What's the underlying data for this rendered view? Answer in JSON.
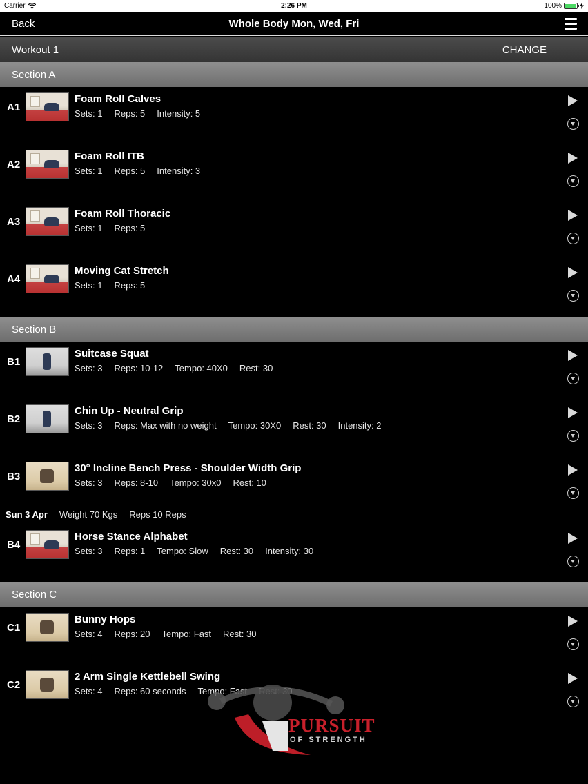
{
  "status_bar": {
    "carrier": "Carrier",
    "time": "2:26 PM",
    "battery": "100%"
  },
  "nav": {
    "back": "Back",
    "title": "Whole Body Mon, Wed, Fri",
    "menu_icon": "hamburger-menu-icon"
  },
  "workout": {
    "name": "Workout 1",
    "change": "CHANGE"
  },
  "sections": [
    {
      "title": "Section A"
    },
    {
      "title": "Section B"
    },
    {
      "title": "Section C"
    }
  ],
  "exercises": [
    {
      "code": "A1",
      "name": "Foam Roll Calves",
      "details": [
        "Sets: 1",
        "Reps: 5",
        "Intensity: 5"
      ]
    },
    {
      "code": "A2",
      "name": "Foam Roll ITB",
      "details": [
        "Sets: 1",
        "Reps: 5",
        "Intensity: 3"
      ]
    },
    {
      "code": "A3",
      "name": "Foam Roll Thoracic",
      "details": [
        "Sets: 1",
        "Reps: 5"
      ]
    },
    {
      "code": "A4",
      "name": "Moving Cat Stretch",
      "details": [
        "Sets: 1",
        "Reps: 5"
      ]
    },
    {
      "code": "B1",
      "name": "Suitcase Squat",
      "details": [
        "Sets: 3",
        "Reps: 10-12",
        "Tempo: 40X0",
        "Rest: 30"
      ]
    },
    {
      "code": "B2",
      "name": "Chin Up - Neutral Grip",
      "details": [
        "Sets: 3",
        "Reps: Max with no weight",
        "Tempo: 30X0",
        "Rest: 30",
        "Intensity: 2"
      ]
    },
    {
      "code": "B3",
      "name": "30° Incline Bench Press - Shoulder Width Grip",
      "details": [
        "Sets: 3",
        "Reps: 8-10",
        "Tempo: 30x0",
        "Rest: 10"
      ]
    },
    {
      "code": "B4",
      "name": "Horse Stance Alphabet",
      "details": [
        "Sets: 3",
        "Reps: 1",
        "Tempo: Slow",
        "Rest: 30",
        "Intensity: 30"
      ]
    },
    {
      "code": "C1",
      "name": "Bunny Hops",
      "details": [
        "Sets: 4",
        "Reps: 20",
        "Tempo: Fast",
        "Rest: 30"
      ]
    },
    {
      "code": "C2",
      "name": "2 Arm Single Kettlebell Swing",
      "details": [
        "Sets: 4",
        "Reps: 60 seconds",
        "Tempo: Fast",
        "Rest: 30"
      ]
    }
  ],
  "history": {
    "date": "Sun 3 Apr",
    "weight": "Weight 70 Kgs",
    "reps": "Reps 10 Reps"
  },
  "logo": {
    "line1": "PURSUIT",
    "line2": "OF STRENGTH"
  }
}
